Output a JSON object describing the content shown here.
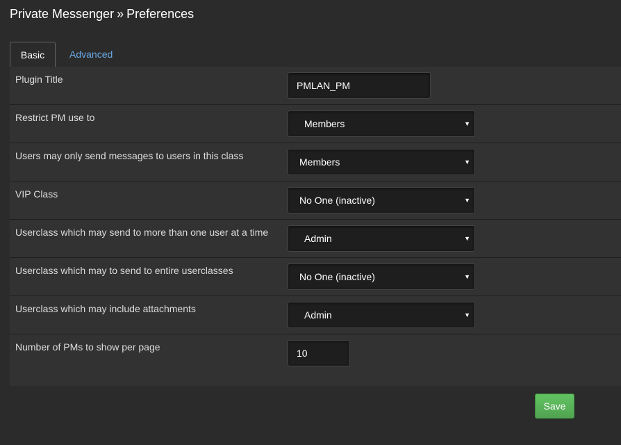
{
  "header": {
    "app_name": "Private Messenger",
    "separator": "»",
    "section": "Preferences"
  },
  "tabs": [
    {
      "label": "Basic",
      "active": true
    },
    {
      "label": "Advanced",
      "active": false
    }
  ],
  "settings": [
    {
      "label": "Plugin Title",
      "control": "text",
      "value": "PMLAN_PM"
    },
    {
      "label": "Restrict PM use to",
      "control": "select",
      "value": "Members"
    },
    {
      "label": "Users may only send messages to users in this class",
      "control": "select",
      "value": "Members"
    },
    {
      "label": "VIP Class",
      "control": "select",
      "value": "No One (inactive)"
    },
    {
      "label": "Userclass which may send to more than one user at a time",
      "control": "select",
      "value": "Admin"
    },
    {
      "label": "Userclass which may to send to entire userclasses",
      "control": "select",
      "value": "No One (inactive)"
    },
    {
      "label": "Userclass which may include attachments",
      "control": "select",
      "value": "Admin"
    },
    {
      "label": "Number of PMs to show per page",
      "control": "text",
      "value": "10"
    }
  ],
  "actions": {
    "save_label": "Save"
  },
  "icons": {
    "dropdown_caret": "caret-down-icon"
  },
  "colors": {
    "background": "#2b2b2b",
    "panel": "#323232",
    "link": "#6aa9e4",
    "save_button": "#5bb75b"
  }
}
